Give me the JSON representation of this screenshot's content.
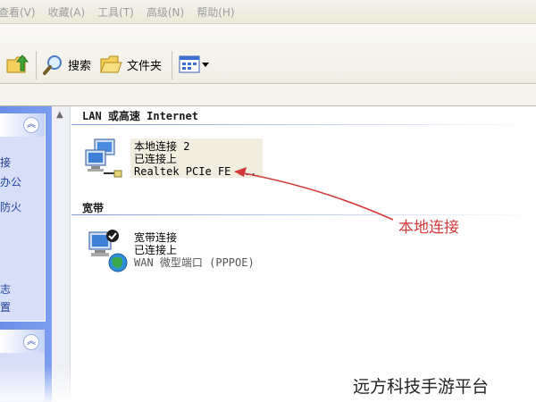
{
  "menubar": {
    "items": [
      "查看(V)",
      "收藏(A)",
      "工具(T)",
      "高级(N)",
      "帮助(H)"
    ]
  },
  "toolbar": {
    "up_icon": "folder-up-icon",
    "search_label": "搜索",
    "folders_label": "文件夹",
    "views_icon": "views-icon"
  },
  "sidebar": {
    "links": [
      "接",
      "办公",
      "防火",
      "志",
      "置"
    ]
  },
  "groups": {
    "lan_header": "LAN 或高速 Internet",
    "broadband_header": "宽带"
  },
  "connections": {
    "local": {
      "name": "本地连接 2",
      "status": "已连接上",
      "device": "Realtek PCIe FE ..."
    },
    "broadband": {
      "name": "宽带连接",
      "status": "已连接上",
      "device": "WAN 微型端口 (PPPOE)"
    }
  },
  "annotation": {
    "label": "本地连接",
    "color": "#d23a3a"
  },
  "watermark": "远方科技手游平台"
}
